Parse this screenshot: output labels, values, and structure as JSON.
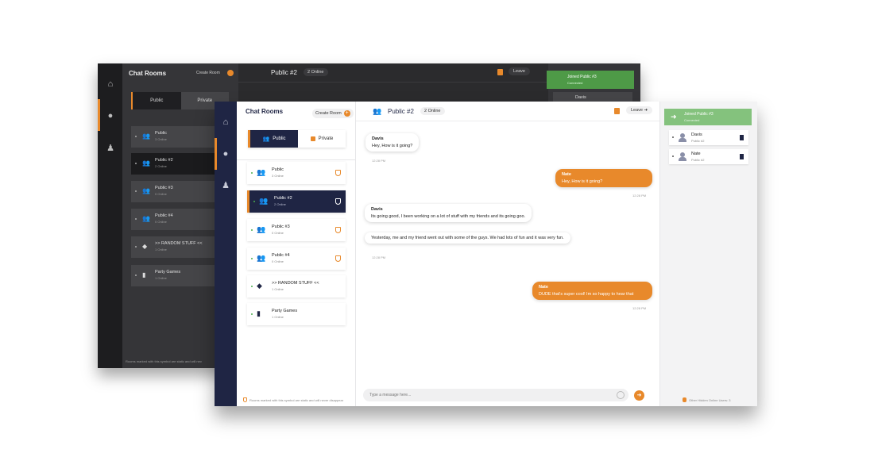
{
  "colors": {
    "accent": "#e8892b",
    "navy": "#1f2544",
    "success": "#84c27d",
    "dark_bg": "#2b2b2d"
  },
  "dark_window": {
    "title": "Chat Rooms",
    "create_room": "Create Room",
    "tabs": [
      "Public",
      "Private"
    ],
    "rooms": [
      {
        "name": "Public",
        "online": "3 Online"
      },
      {
        "name": "Public #2",
        "online": "2 Online"
      },
      {
        "name": "Public #3",
        "online": "0 Online"
      },
      {
        "name": "Public #4",
        "online": "0 Online"
      },
      {
        "name": ">> RANDOM STUFF <<",
        "online": "1 Online"
      },
      {
        "name": "Party Games",
        "online": "1 Online"
      }
    ],
    "footer": "Rooms marked with this symbol are static and will nev",
    "room_title": "Public #2",
    "room_online": "2 Online",
    "leave": "Leave",
    "toast_title": "Joined Public #3",
    "toast_sub": "Connected",
    "user": "Davis"
  },
  "sidebar": {
    "title": "Chat Rooms",
    "create_room": "Create Room",
    "tabs": {
      "public": "Public",
      "private": "Private"
    },
    "rooms": [
      {
        "name": "Public",
        "online": "3 Online",
        "icon": "group-icon"
      },
      {
        "name": "Public #2",
        "online": "2 Online",
        "icon": "group-icon"
      },
      {
        "name": "Public #3",
        "online": "0 Online",
        "icon": "group-icon"
      },
      {
        "name": "Public #4",
        "online": "0 Online",
        "icon": "group-icon"
      },
      {
        "name": ">> RANDOM STUFF <<",
        "online": "1 Online",
        "icon": "shapes-icon"
      },
      {
        "name": "Party Games",
        "online": "1 Online",
        "icon": "gameboy-icon"
      }
    ],
    "footer": "Rooms marked with this symbol are static and will never disappear"
  },
  "chat": {
    "room_title": "Public #2",
    "online": "2 Online",
    "leave": "Leave",
    "messages": [
      {
        "author": "Davis",
        "text": "Hey, How is it going?",
        "time": "12:28 PM"
      },
      {
        "author": "Nate",
        "text": "Hey, How is it going?",
        "time": "12:28 PM"
      },
      {
        "author": "Davis",
        "text": "Its going good, I been working on a lot of stuff with my friends and its going goo."
      },
      {
        "text": "Yesterday, me and my friend went out with some of the guys.  We had lots of fun and it was very fun.",
        "time": "12:28 PM"
      },
      {
        "author": "Nate",
        "text": "DUDE that's super cool!  Im so happy to hear that",
        "time": "12:28 PM"
      }
    ],
    "input_placeholder": "Type a message here..."
  },
  "right_panel": {
    "toast_title": "Joined Public #3",
    "toast_sub": "Connected",
    "users": [
      {
        "name": "Davis",
        "room": "Public #2"
      },
      {
        "name": "Nate",
        "room": "Public #2"
      }
    ],
    "footer": "Other Hidden Online Users:  3"
  }
}
